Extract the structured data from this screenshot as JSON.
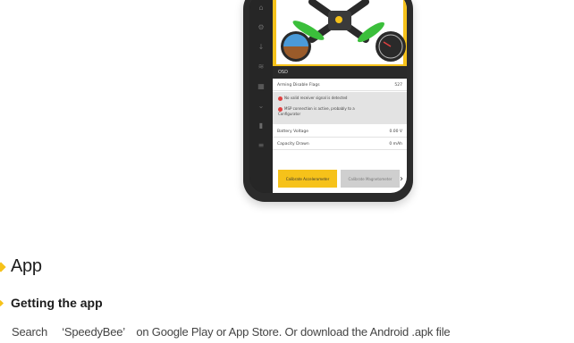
{
  "phone": {
    "bar_label": "OSD",
    "rows": [
      {
        "label": "Arming Disable Flags",
        "value": "527"
      },
      {
        "label": "Battery Voltage",
        "value": "0.00 V"
      },
      {
        "label": "Capacity Drawn",
        "value": "0 mAh"
      }
    ],
    "warnings": [
      "No valid receiver signal is detected",
      "MSP connection is active, probably to a Configurator"
    ],
    "buttons": {
      "left": "Calibrate Accelerometer",
      "right": "Calibrate Magnetometer"
    }
  },
  "colors": {
    "accent": "#f6c21a",
    "drone_arm": "#2a2a2a",
    "propeller": "#3bbf3b"
  },
  "section": {
    "title": "App"
  },
  "subsection": {
    "title": "Getting the app"
  },
  "body": {
    "text": "Search 　‘SpeedyBee’　on Google Play or App Store. Or download the Android .apk file"
  }
}
